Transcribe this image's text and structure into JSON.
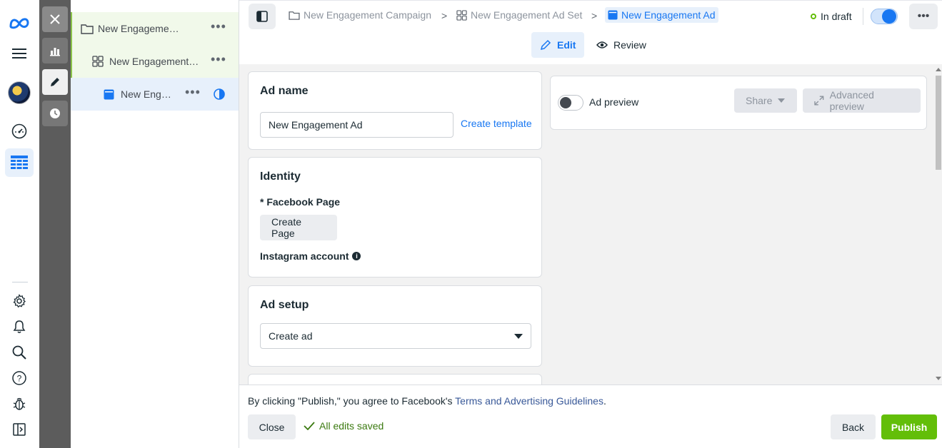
{
  "rail": {
    "items": [
      "meta-logo",
      "menu",
      "avatar",
      "performance",
      "ads-manager",
      "settings",
      "notifications",
      "search",
      "help",
      "report-bug",
      "toggle-panel"
    ]
  },
  "tree": {
    "campaign": "New Engagement Campaign",
    "adset": "New Engagement Ad Set",
    "ad": "New Engagement Ad"
  },
  "breadcrumb": {
    "campaign": "New Engagement Campaign",
    "adset": "New Engagement Ad Set",
    "ad": "New Engagement Ad"
  },
  "status": {
    "label": "In draft"
  },
  "tabs": {
    "edit": "Edit",
    "review": "Review"
  },
  "ad_name_card": {
    "title": "Ad name",
    "value": "New Engagement Ad",
    "template_link": "Create template"
  },
  "identity_card": {
    "title": "Identity",
    "facebook_page_label": "* Facebook Page",
    "create_page_label": "Create Page",
    "instagram_label": "Instagram account"
  },
  "ad_setup_card": {
    "title": "Ad setup",
    "select_value": "Create ad"
  },
  "preview": {
    "label": "Ad preview",
    "share_label": "Share",
    "advanced_label": "Advanced preview"
  },
  "footer": {
    "terms_prefix": "By clicking \"Publish,\" you agree to Facebook's ",
    "terms_link": "Terms and Advertising Guidelines",
    "terms_suffix": ".",
    "close_label": "Close",
    "saved_label": "All edits saved",
    "back_label": "Back",
    "publish_label": "Publish"
  },
  "colors": {
    "accent": "#1877f2",
    "publish": "#63be09",
    "saved": "#3b7a10"
  }
}
